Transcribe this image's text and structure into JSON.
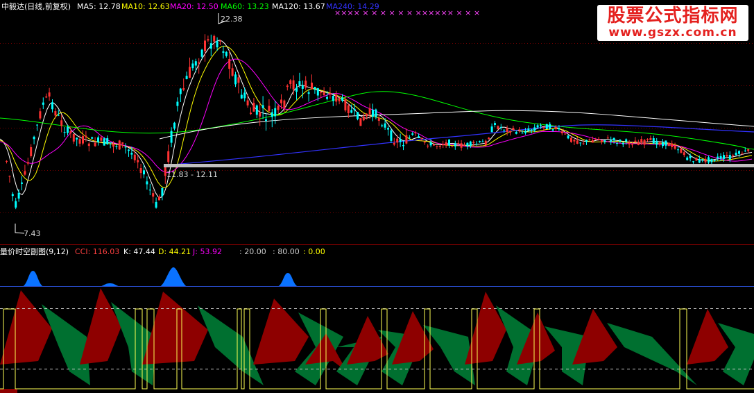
{
  "colors": {
    "background": "#000000",
    "grid": "#7a0000",
    "divider": "#9a0000",
    "up": "#00ffff",
    "down": "#ff3232",
    "ma5": "#ffffff",
    "ma10": "#ffff00",
    "ma20": "#ff00ff",
    "ma60": "#00ff00",
    "ma120": "#ffffff",
    "ma240": "#3232ff",
    "support_line": "#bfbfbf",
    "cci_area": "#0a72ff",
    "cci_line": "#2a4fd4",
    "k_area": "#8e0000",
    "d_area": "#007030",
    "dash": "#cccccc",
    "j_line": "#ffff55",
    "marker": "#ff44ff"
  },
  "main_panel": {
    "legend": [
      {
        "text": "中毅达(日线,前复权)",
        "color": "#ffffff"
      },
      {
        "text": "MA5: 12.78",
        "color": "#ffffff"
      },
      {
        "text": "MA10: 12.63",
        "color": "#ffff00"
      },
      {
        "text": "MA20: 12.50",
        "color": "#ff00ff"
      },
      {
        "text": "MA60: 13.23",
        "color": "#00ff00"
      },
      {
        "text": "MA120: 13.67",
        "color": "#ffffff"
      },
      {
        "text": "MA240: 14.29",
        "color": "#3232ff"
      }
    ],
    "annotations": {
      "high": "22.38",
      "low": "7.43",
      "range": "11.83 - 12.11"
    },
    "top_markers": "××××  ×  ×     ×  ×  ×     ×     ××××××  ×  ×  ×"
  },
  "sub_panel": {
    "legend": [
      {
        "text": "量价时空副图(9,12)",
        "color": "#ffffff"
      },
      {
        "text": "CCI: 116.03",
        "color": "#ff4040"
      },
      {
        "text": "K: 47.44",
        "color": "#ffffff"
      },
      {
        "text": "D: 44.21",
        "color": "#ffff00"
      },
      {
        "text": "J: 53.92",
        "color": "#ff00ff"
      },
      {
        "text": ": 20.00",
        "color": "#cccccc"
      },
      {
        "text": ": 80.00",
        "color": "#cccccc"
      },
      {
        "text": ": 0.00",
        "color": "#ffff00"
      }
    ]
  },
  "watermark": {
    "title": "股票公式指标网",
    "url": "www.gszx.com.cn"
  }
}
